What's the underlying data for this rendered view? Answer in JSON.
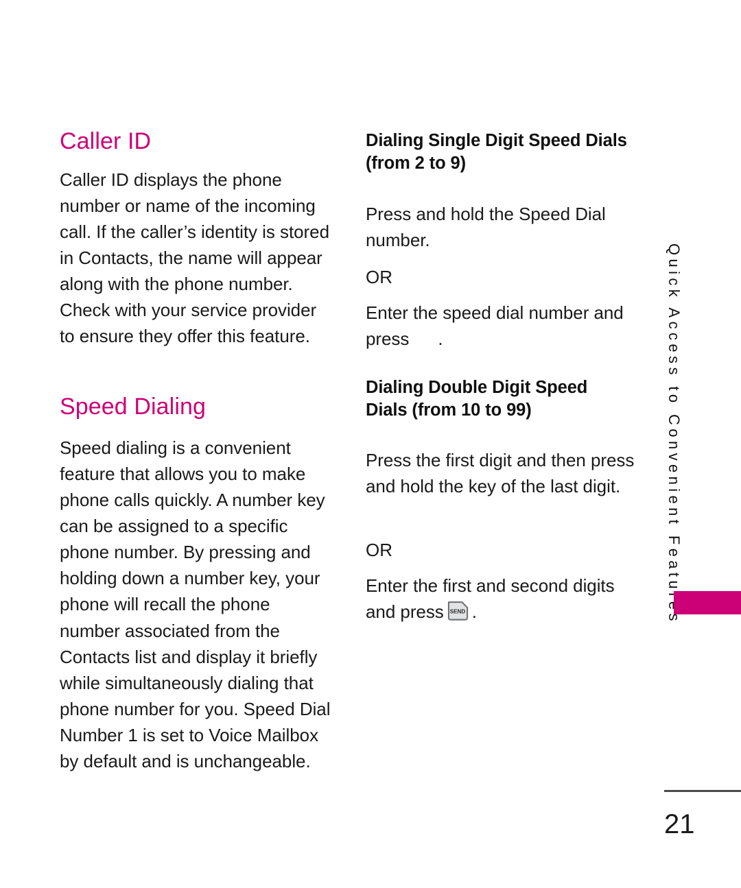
{
  "page": {
    "number": "21",
    "accent_color": "#CC0077",
    "text_color": "#1a1a1a",
    "background_color": "#ffffff"
  },
  "side_tab": {
    "label": "Quick Access to Convenient Features",
    "marker_color": "#CC0077"
  },
  "left_column": {
    "caller_id": {
      "heading": "Caller ID",
      "body": "Caller ID displays the phone number or name of the incoming call. If the caller’s identity is stored in Contacts, the name will appear along with the phone number. Check with your service provider to ensure they offer this feature."
    },
    "speed_dialing": {
      "heading": "Speed Dialing",
      "body": "Speed dialing is a convenient feature that allows you to make phone calls quickly. A number key can be assigned to a specific phone number. By pressing and holding down a number key, your phone will recall the phone number associated from the Contacts list and display it briefly while simultaneously dialing that phone number for you. Speed Dial Number 1 is set to Voice Mailbox by default and is unchangeable."
    }
  },
  "right_column": {
    "single_digit": {
      "heading": "Dialing Single Digit Speed Dials (from 2 to 9)",
      "body": "Press and hold the Speed Dial number.",
      "or_label": "OR",
      "alt_prefix": "Enter the speed dial number and press",
      "alt_suffix": "."
    },
    "double_digit": {
      "heading": "Dialing Double Digit Speed Dials (from 10 to 99)",
      "body": "Press the first digit and then press and hold the key of the last digit.",
      "or_label": "OR",
      "alt_prefix": "Enter the first and second digits and press",
      "alt_suffix": ".",
      "key_icon_label": "SEND"
    }
  }
}
